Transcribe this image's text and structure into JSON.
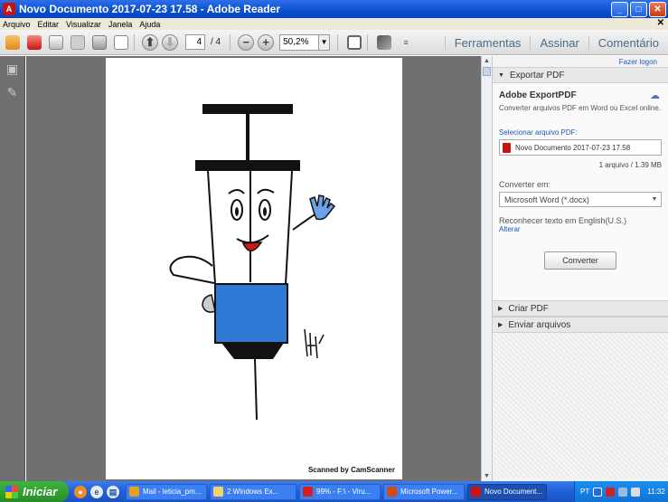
{
  "window": {
    "title": "Novo Documento 2017-07-23 17.58 - Adobe Reader",
    "app_icon": "A"
  },
  "menu": {
    "items": [
      "Arquivo",
      "Editar",
      "Visualizar",
      "Janela",
      "Ajuda"
    ]
  },
  "toolbar": {
    "page_current": "4",
    "page_total": "/ 4",
    "zoom": "50,2%",
    "links": [
      "Ferramentas",
      "Assinar",
      "Comentário"
    ]
  },
  "document": {
    "footer": "Scanned by CamScanner"
  },
  "panel": {
    "logout": "Fazer logon",
    "export_header": "Exportar PDF",
    "export_title": "Adobe ExportPDF",
    "export_desc": "Converter arquivos PDF em Word ou Excel online.",
    "select_label": "Selecionar arquivo PDF:",
    "file_name": "Novo Documento 2017-07-23 17.58",
    "file_info": "1 arquivo / 1.39 MB",
    "convert_label": "Converter em:",
    "convert_value": "Microsoft Word (*.docx)",
    "recognize_text": "Reconhecer texto em English(U.S.)",
    "change_link": "Alterar",
    "convert_button": "Converter",
    "create_header": "Criar PDF",
    "send_header": "Enviar arquivos"
  },
  "taskbar": {
    "start": "Iniciar",
    "tasks": [
      {
        "label": "Mail - leticia_pm...",
        "color": "#e8a020"
      },
      {
        "label": "2 Windows Ex...",
        "color": "#f3d46a"
      },
      {
        "label": "99% - F:\\ - Viru...",
        "color": "#d42020"
      },
      {
        "label": "Microsoft Power...",
        "color": "#d04a1a"
      },
      {
        "label": "Novo Document...",
        "color": "#c8140e"
      }
    ],
    "lang": "PT",
    "clock": "11:32"
  }
}
